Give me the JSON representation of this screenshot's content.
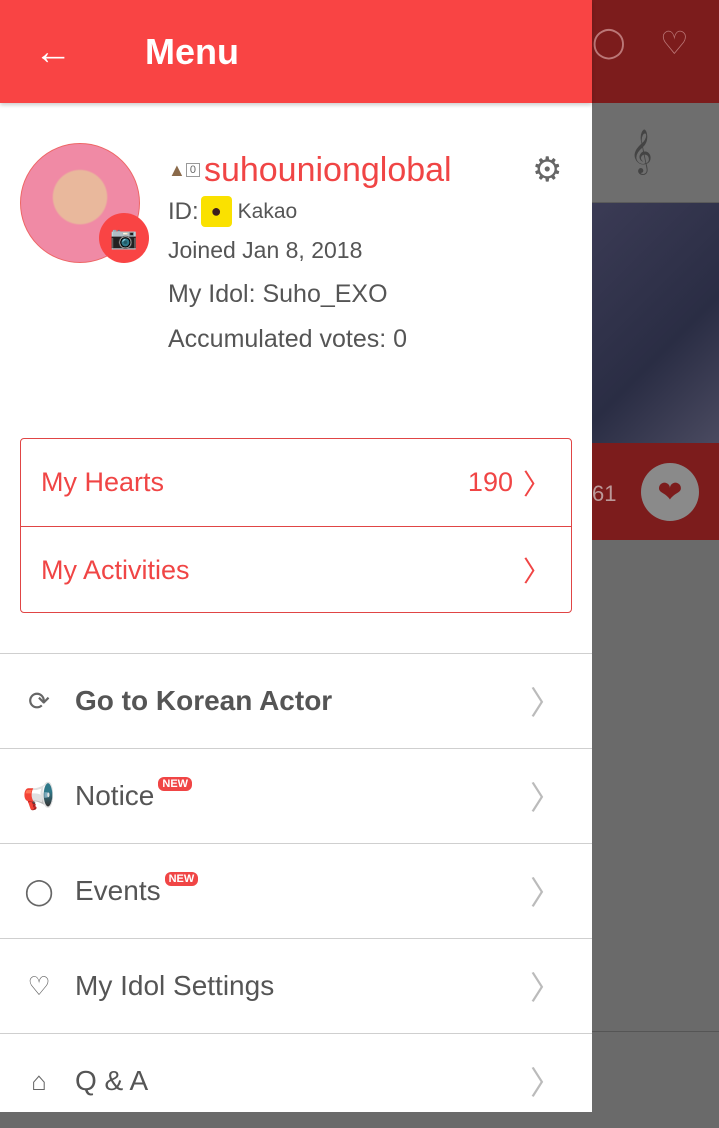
{
  "header": {
    "title": "Menu",
    "back_icon": "arrow-left-icon"
  },
  "profile": {
    "level": "0",
    "username": "suhounionglobal",
    "id_label": "ID:",
    "id_provider": "Kakao",
    "joined": "Joined Jan 8, 2018",
    "idol": "My Idol: Suho_EXO",
    "votes": "Accumulated votes: 0"
  },
  "box": [
    {
      "label": "My Hearts",
      "value": "190"
    },
    {
      "label": "My Activities",
      "value": ""
    }
  ],
  "menu": [
    {
      "label": "Go to Korean Actor",
      "icon": "heart-swap-icon",
      "new": ""
    },
    {
      "label": "Notice",
      "icon": "megaphone-icon",
      "new": "NEW"
    },
    {
      "label": "Events",
      "icon": "balloon-icon",
      "new": "NEW"
    },
    {
      "label": "My Idol Settings",
      "icon": "heart-question-icon",
      "new": ""
    },
    {
      "label": "Q & A",
      "icon": "house-heart-icon",
      "new": ""
    }
  ],
  "background": {
    "vote_count": "61"
  },
  "colors": {
    "accent": "#f94444",
    "kakao": "#fae100"
  }
}
